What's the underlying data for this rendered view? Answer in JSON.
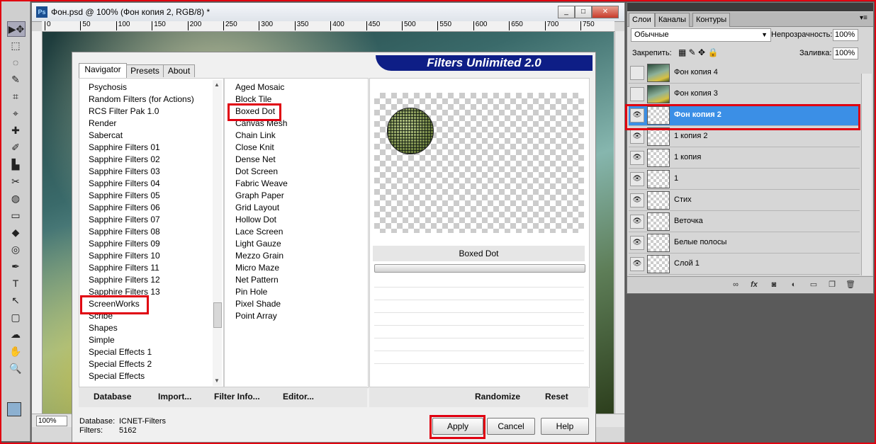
{
  "document": {
    "title": "Фон.psd @ 100% (Фон копия 2, RGB/8) *",
    "app_badge": "Ps",
    "zoom": "100%",
    "ruler_ticks": [
      "0",
      "50",
      "100",
      "150",
      "200",
      "250",
      "300",
      "350",
      "400",
      "450",
      "500",
      "550",
      "600",
      "650",
      "700",
      "750"
    ],
    "window_buttons": [
      "_",
      "□",
      "✕"
    ]
  },
  "tools": [
    "▶✥",
    "⬚",
    "◌",
    "✎",
    "⌗",
    "⌖",
    "✚",
    "✐",
    "▙",
    "✂",
    "◍",
    "▭",
    "◆",
    "◎",
    "✒",
    "T",
    "↖",
    "▢",
    "☁",
    "✋",
    "🔍"
  ],
  "dialog": {
    "product_title": "Filters Unlimited 2.0",
    "tabs": [
      "Navigator",
      "Presets",
      "About"
    ],
    "categories": [
      "Psychosis",
      "Random Filters (for Actions)",
      "RCS Filter Pak 1.0",
      "Render",
      "Sabercat",
      "Sapphire Filters 01",
      "Sapphire Filters 02",
      "Sapphire Filters 03",
      "Sapphire Filters 04",
      "Sapphire Filters 05",
      "Sapphire Filters 06",
      "Sapphire Filters 07",
      "Sapphire Filters 08",
      "Sapphire Filters 09",
      "Sapphire Filters 10",
      "Sapphire Filters 11",
      "Sapphire Filters 12",
      "Sapphire Filters 13",
      "ScreenWorks",
      "Scribe",
      "Shapes",
      "Simple",
      "Special Effects 1",
      "Special Effects 2",
      "Special Effects"
    ],
    "filters": [
      "Aged Mosaic",
      "Block Tile",
      "Boxed Dot",
      "Canvas Mesh",
      "Chain Link",
      "Close Knit",
      "Dense Net",
      "Dot Screen",
      "Fabric Weave",
      "Graph Paper",
      "Grid Layout",
      "Hollow Dot",
      "Lace Screen",
      "Light Gauze",
      "Mezzo Grain",
      "Micro Maze",
      "Net Pattern",
      "Pin Hole",
      "Pixel Shade",
      "Point Array"
    ],
    "selected_filter": "Boxed Dot",
    "bottom_links_left": [
      "Database",
      "Import...",
      "Filter Info...",
      "Editor..."
    ],
    "bottom_links_right": [
      "Randomize",
      "Reset"
    ],
    "db_label": "Database:",
    "db_value": "ICNET-Filters",
    "filters_label": "Filters:",
    "filters_value": "5162",
    "apply": "Apply",
    "cancel": "Cancel",
    "help": "Help"
  },
  "layers_panel": {
    "tabs": [
      "Слои",
      "Каналы",
      "Контуры"
    ],
    "blend_mode": "Обычные",
    "opacity_label": "Непрозрачность:",
    "opacity": "100%",
    "lock_label": "Закрепить:",
    "fill_label": "Заливка:",
    "fill": "100%",
    "layers": [
      {
        "name": "Фон копия 4",
        "visible": false,
        "thumb": "image"
      },
      {
        "name": "Фон копия 3",
        "visible": false,
        "thumb": "image"
      },
      {
        "name": "Фон копия 2",
        "visible": true,
        "thumb": "transparent",
        "selected": true
      },
      {
        "name": "1 копия 2",
        "visible": true,
        "thumb": "transparent"
      },
      {
        "name": "1 копия",
        "visible": true,
        "thumb": "transparent"
      },
      {
        "name": "1",
        "visible": true,
        "thumb": "transparent"
      },
      {
        "name": "Стих",
        "visible": true,
        "thumb": "transparent"
      },
      {
        "name": "Веточка",
        "visible": true,
        "thumb": "transparent"
      },
      {
        "name": "Белые полосы",
        "visible": true,
        "thumb": "transparent"
      },
      {
        "name": "Слой 1",
        "visible": true,
        "thumb": "transparent"
      }
    ],
    "footer_icons": [
      "link-icon",
      "fx-icon",
      "mask-icon",
      "adjustment-icon",
      "folder-icon",
      "new-layer-icon",
      "trash-icon"
    ]
  },
  "colors": {
    "highlight": "#e00010",
    "selected_layer": "#3b8fe6",
    "banner": "#0e1e86"
  }
}
